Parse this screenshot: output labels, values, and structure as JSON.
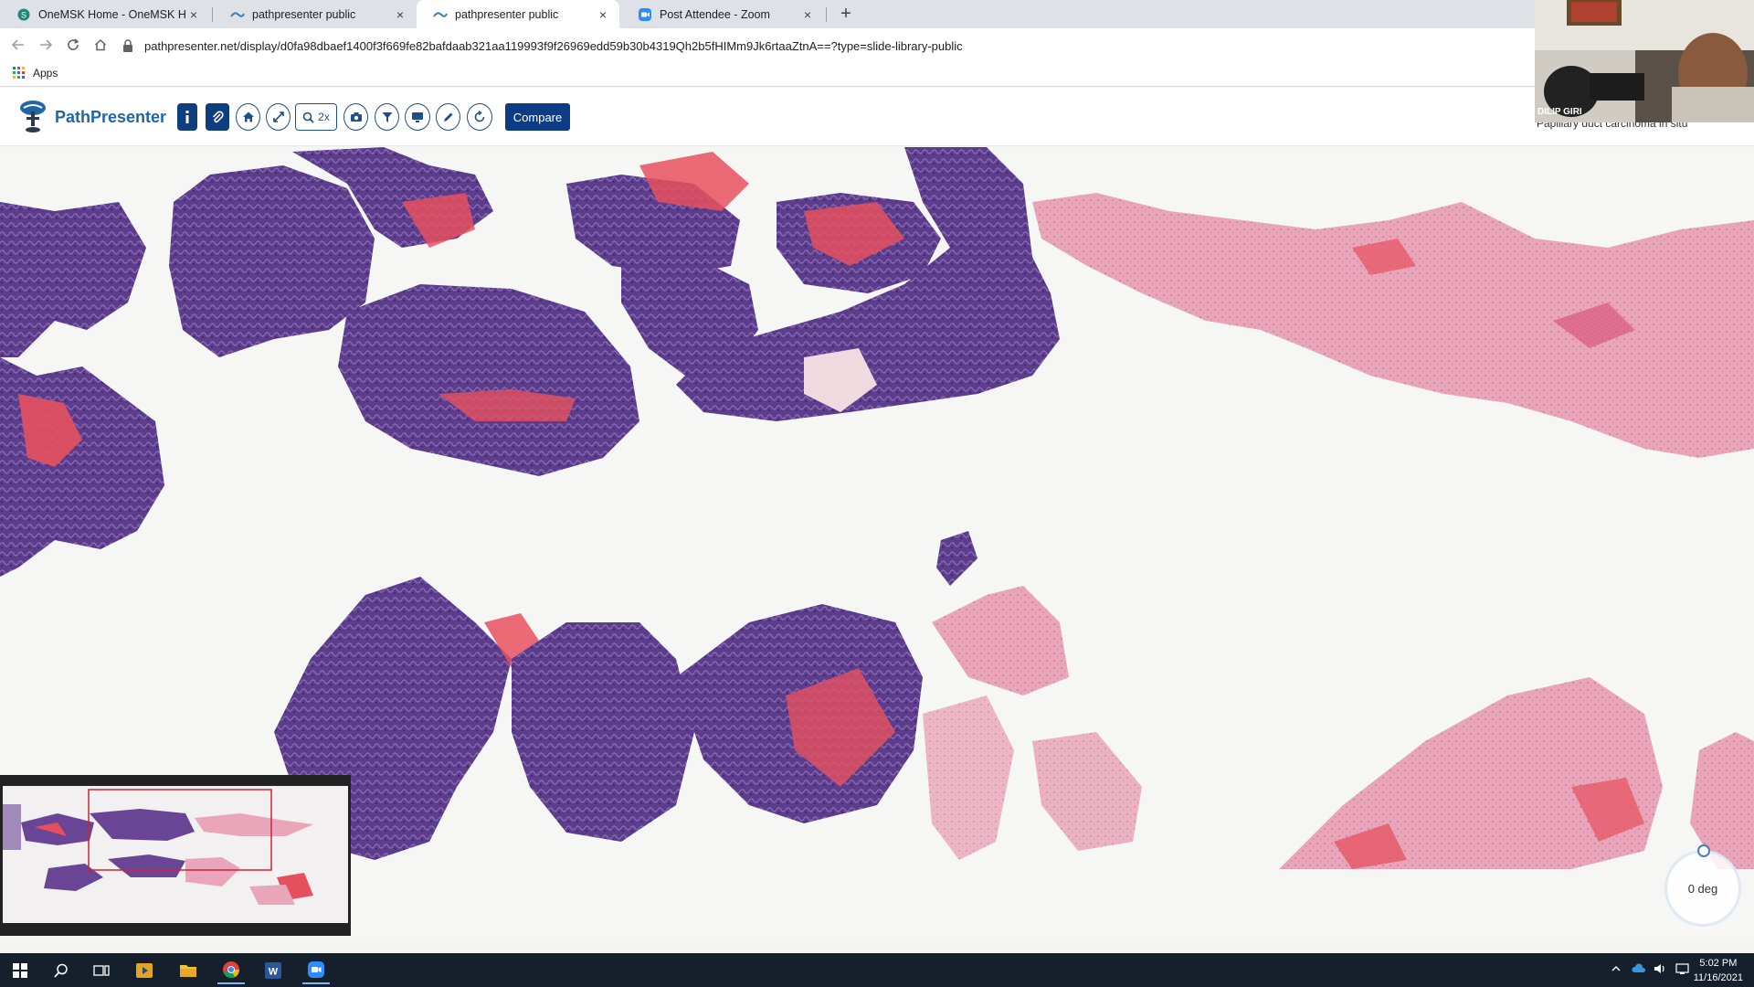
{
  "browser": {
    "tabs": [
      {
        "title": "OneMSK Home - OneMSK Home",
        "close": "×"
      },
      {
        "title": "pathpresenter public",
        "close": "×"
      },
      {
        "title": "pathpresenter public",
        "close": "×"
      },
      {
        "title": "Post Attendee - Zoom",
        "close": "×"
      }
    ],
    "new_tab": "+",
    "url": "pathpresenter.net/display/d0fa98dbaef1400f3f669fe82bafdaab321aa119993f9f26969edd59b30b4319Qh2b5fHIMm9Jk6rtaaZtnA==?type=slide-library-public",
    "bookmarks": {
      "apps_label": "Apps"
    }
  },
  "app": {
    "logo_text": "PathPresenter",
    "zoom_label": "2x",
    "compare_label": "Compare",
    "slide_title": "Papillary duct carcinoma in situ"
  },
  "viewer": {
    "rotation_label": "0 deg"
  },
  "video": {
    "participant_name": "DILIP GIRI"
  },
  "taskbar": {
    "time": "5:02 PM",
    "date": "11/16/2021"
  },
  "colors": {
    "brand": "#1f66a8",
    "compare_bg": "#0b3c85",
    "tissue_purple": "#5a3a8a",
    "tissue_pink": "#e7a0b6",
    "blood_red": "#e8505e"
  }
}
